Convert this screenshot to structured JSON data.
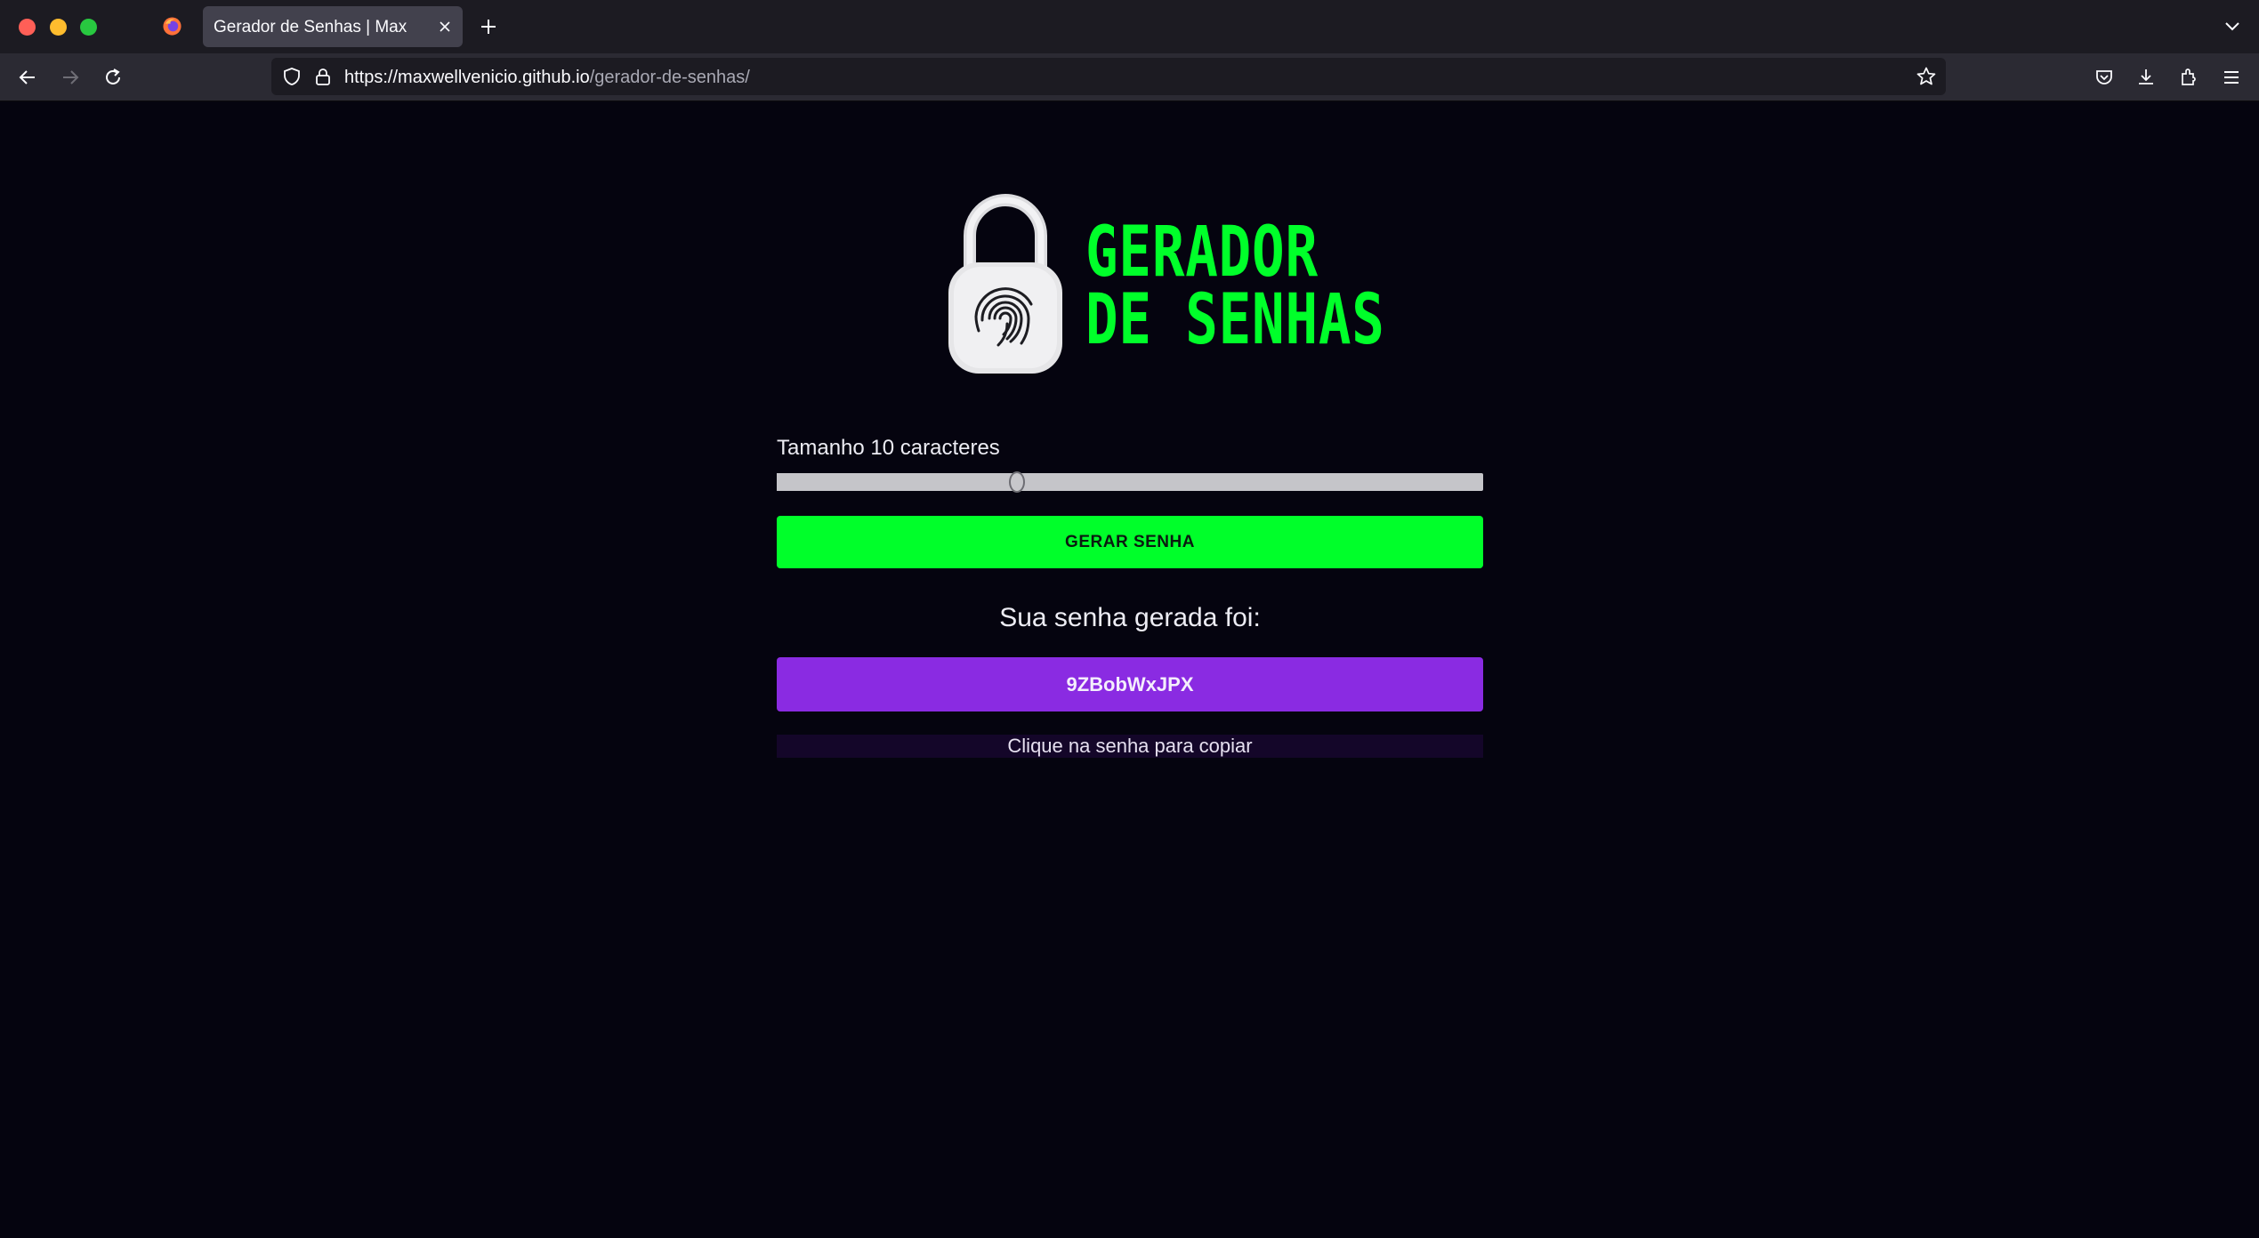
{
  "browser": {
    "tab_title": "Gerador de Senhas | Max",
    "url_host": "https://maxwellvenicio.github.io",
    "url_path": "/gerador-de-senhas/"
  },
  "logo": {
    "line1": "GERADOR",
    "line2": "DE SENHAS",
    "colors": {
      "accent": "#00ff2a",
      "lock_body": "#e6e6e8"
    }
  },
  "generator": {
    "size_label": "Tamanho 10 caracteres",
    "slider_value": 10,
    "slider_fraction": 0.34,
    "button_label": "GERAR SENHA",
    "result_label": "Sua senha gerada foi:",
    "password": "9ZBobWxJPX",
    "copy_hint": "Clique na senha para copiar"
  },
  "colors": {
    "page_bg": "#05040f",
    "button_green": "#00ff2a",
    "password_purple": "#8a2be2"
  },
  "icons": {
    "back": "back-arrow-icon",
    "forward": "forward-arrow-icon",
    "reload": "reload-icon",
    "shield": "shield-icon",
    "lock": "lock-icon",
    "star": "bookmark-star-icon",
    "pocket": "pocket-icon",
    "downloads": "download-icon",
    "extensions": "extensions-icon",
    "menu": "hamburger-menu-icon"
  }
}
